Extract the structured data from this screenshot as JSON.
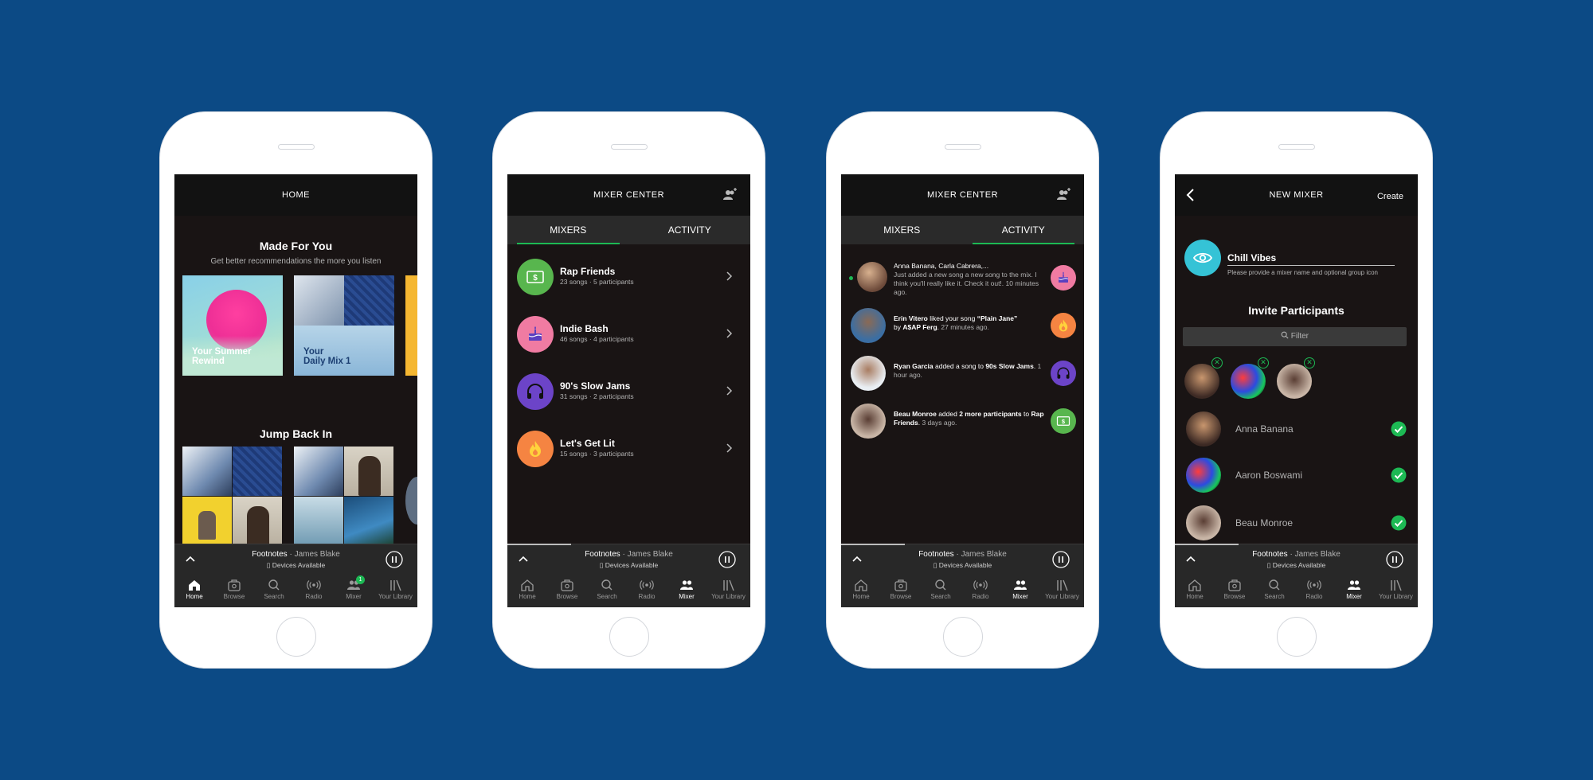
{
  "colors": {
    "background": "#0c4a85",
    "accent": "#1db954",
    "screen": "#191414"
  },
  "player": {
    "track": "Footnotes",
    "separator": " · ",
    "artist": "James Blake",
    "devices": "Devices Available"
  },
  "nav": [
    {
      "label": "Home",
      "icon": "home-icon"
    },
    {
      "label": "Browse",
      "icon": "browse-icon"
    },
    {
      "label": "Search",
      "icon": "search-icon"
    },
    {
      "label": "Radio",
      "icon": "radio-icon"
    },
    {
      "label": "Mixer",
      "icon": "mixer-icon"
    },
    {
      "label": "Your Library",
      "icon": "library-icon"
    }
  ],
  "home": {
    "title": "HOME",
    "mixer_badge": "1",
    "made_for_you": {
      "heading": "Made For You",
      "subtitle": "Get better recommendations the more you listen"
    },
    "cards": [
      {
        "line1": "Your Summer",
        "line2": "Rewind"
      },
      {
        "line1": "Your",
        "line2": "Daily Mix 1"
      }
    ],
    "jump_back_in": "Jump Back In"
  },
  "mixer_center": {
    "title": "MIXER CENTER",
    "tabs": [
      "MIXERS",
      "ACTIVITY"
    ],
    "mixers": [
      {
        "name": "Rap Friends",
        "meta": "23 songs · 5 participants",
        "color": "#58b64e",
        "icon": "money-icon"
      },
      {
        "name": "Indie Bash",
        "meta": "46 songs · 4 participants",
        "color": "#f07ba2",
        "icon": "cake-icon"
      },
      {
        "name": "90's Slow Jams",
        "meta": "31 songs · 2 participants",
        "color": "#6c44c8",
        "icon": "headphones-icon"
      },
      {
        "name": "Let's Get Lit",
        "meta": "15 songs · 3 participants",
        "color": "#f58442",
        "icon": "flame-icon"
      }
    ]
  },
  "activity": [
    {
      "who": "Anna Banana, Carla Cabrera,...",
      "text": "Just added a new song a new song to the mix. I think you'll really like it. Check it out!.",
      "time": "10 minutes ago.",
      "icon": "cake-icon",
      "color": "#f07ba2"
    },
    {
      "who": "Erin Vitero",
      "mid": " liked your song ",
      "song": "“Plain Jane”",
      "by": " by ",
      "artist": "A$AP Ferg",
      "time": "27 minutes ago.",
      "icon": "flame-icon",
      "color": "#f58442"
    },
    {
      "who": "Ryan Garcia",
      "mid": " added a song to ",
      "target": "90s Slow Jams",
      "time": "1 hour ago.",
      "icon": "headphones-icon",
      "color": "#6c44c8"
    },
    {
      "who": "Beau Monroe",
      "mid": " added ",
      "bold": "2 more participants",
      "to": " to ",
      "target": "Rap Friends",
      "time": "3 days ago.",
      "icon": "money-icon",
      "color": "#58b64e"
    }
  ],
  "new_mixer": {
    "title": "NEW MIXER",
    "create": "Create",
    "name_value": "Chill Vibes",
    "name_hint": "Please provide a mixer name and optional group icon",
    "invite_heading": "Invite Participants",
    "filter_placeholder": "Filter",
    "participants": [
      "Anna Banana",
      "Aaron Boswami",
      "Beau Monroe"
    ]
  }
}
